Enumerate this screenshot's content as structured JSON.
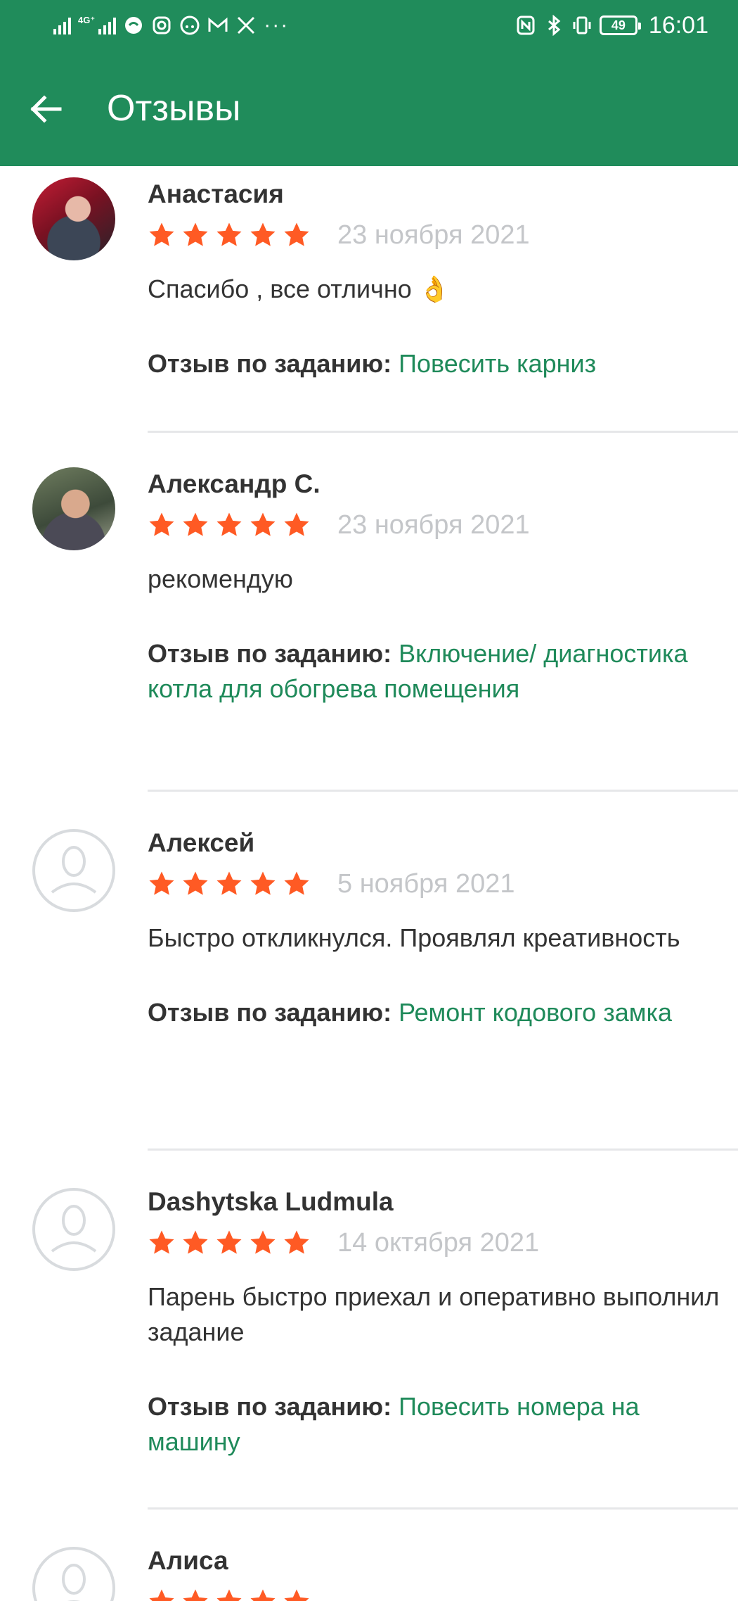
{
  "status_bar": {
    "network_label": "4G⁺",
    "time": "16:01",
    "battery": "49",
    "more": "···",
    "icons": [
      "signal-icon",
      "signal-4g-icon",
      "chat-icon",
      "instagram-icon",
      "cloud-icon",
      "gmail-icon",
      "x-icon",
      "nfc-icon",
      "bluetooth-icon",
      "vibrate-icon",
      "battery-icon"
    ]
  },
  "header": {
    "title": "Отзывы",
    "back_icon": "arrow-left-icon",
    "color": "#208c5b"
  },
  "colors": {
    "star": "#ff5a24",
    "link": "#1f8a5a",
    "date": "#c4c6c9"
  },
  "task_label": "Отзыв по заданию:",
  "reviews": [
    {
      "author": "Анастасия",
      "rating": 5,
      "date": "23 ноября 2021",
      "text": "Спасибо , все отлично 👌",
      "task": "Повесить карниз",
      "avatar": "photo"
    },
    {
      "author": "Александр С.",
      "rating": 5,
      "date": "23 ноября 2021",
      "text": "рекомендую",
      "task": "Включение/ диагностика котла для обогрева помещения",
      "avatar": "photo"
    },
    {
      "author": "Алексей",
      "rating": 5,
      "date": "5 ноября 2021",
      "text": "Быстро откликнулся. Проявлял креативность",
      "task": "Ремонт кодового замка",
      "avatar": "placeholder"
    },
    {
      "author": "Dashytska Ludmula",
      "rating": 5,
      "date": "14 октября 2021",
      "text": "Парень быстро приехал и оперативно выполнил задание",
      "task": "Повесить номера на машину",
      "avatar": "placeholder"
    },
    {
      "author": "Алиса",
      "rating": 5,
      "avatar": "placeholder"
    }
  ]
}
